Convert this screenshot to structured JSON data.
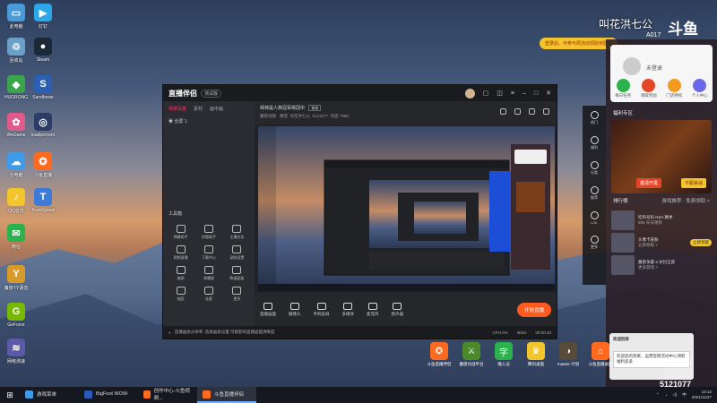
{
  "desktop_icons": [
    {
      "label": "此电脑",
      "color": "#4a9ad8",
      "glyph": "▭"
    },
    {
      "label": "钉钉",
      "color": "#2ea7e8",
      "glyph": "▶"
    },
    {
      "label": "回收站",
      "color": "#6aa0c8",
      "glyph": "♲"
    },
    {
      "label": "Steam",
      "color": "#1b2838",
      "glyph": "●"
    },
    {
      "label": "HUORONG",
      "color": "#3aa54a",
      "glyph": "◆"
    },
    {
      "label": "Sandboxie",
      "color": "#2b5fb3",
      "glyph": "S"
    },
    {
      "label": "WeGame",
      "color": "#e05a8a",
      "glyph": "✿"
    },
    {
      "label": "loadpercent",
      "color": "#2a3d66",
      "glyph": "◎"
    },
    {
      "label": "云电脑",
      "color": "#3f9be8",
      "glyph": "☁"
    },
    {
      "label": "斗鱼直播",
      "color": "#ff6a1f",
      "glyph": "✪"
    },
    {
      "label": "QQ音乐",
      "color": "#f3c52c",
      "glyph": "♪"
    },
    {
      "label": "TeamSpeak",
      "color": "#3c7bd8",
      "glyph": "T"
    },
    {
      "label": "微信",
      "color": "#2bb24c",
      "glyph": "✉"
    },
    {
      "label": "魔兽YY语音",
      "color": "#d89b2a",
      "glyph": "Y"
    },
    {
      "label": "GeForce",
      "color": "#76b900",
      "glyph": "G"
    },
    {
      "label": "网络测速",
      "color": "#5a5aa8",
      "glyph": "≋"
    }
  ],
  "stream_window": {
    "logo": "直播伴侣",
    "version": "测试版",
    "left_tabs": [
      "场景设置",
      "素材",
      "画中画"
    ],
    "scene_item": "全屏 1",
    "tools_label": "工具箱",
    "tools": [
      "弹幕助手",
      "房管助手",
      "主播任务",
      "视频直播",
      "下载中心",
      "录制设置",
      "美颜",
      "弹幕姬",
      "数据面板",
      "抽奖",
      "连麦",
      "更多"
    ],
    "room_title": "拜荷是人族冠军候冠中",
    "room_tag": "修改",
    "room_sub1": "魔兽地图 · 暴雪",
    "room_sub2": "叫花洪七公",
    "room_sub3": "5121077",
    "room_sub4": "热度 7988",
    "bottom_tools": [
      "直播画面",
      "摄像头",
      "手机投屏",
      "多媒体",
      "麦克风",
      "扬声器"
    ],
    "go_live": "开始直播",
    "status_text": "直播画质分辨率: 选择画质设置 可能影响直播画面清晰度",
    "stat_cpu": "CPU:3%",
    "stat_net": "0kb/s",
    "stat_time": "00:00:33"
  },
  "overlay": {
    "watermark": "叫花洪七公",
    "room_number": "斗鱼",
    "a_code": "A017",
    "promo": "登录后，可参与周活动领取奖励哦",
    "login": "未登录",
    "quick": [
      {
        "label": "每日任务",
        "color": "#2bb24c"
      },
      {
        "label": "领取奖励",
        "color": "#e5462a"
      },
      {
        "label": "门店特权",
        "color": "#f39a1f"
      },
      {
        "label": "个人中心",
        "color": "#6a6ae8"
      }
    ],
    "sec_welfare": "福利专区",
    "banner_btn1": "邀请开黑",
    "banner_btn2": "不服来战",
    "sec_rank": "排行榜",
    "sec_rank_more": "游戏推荐 · 免费领取 >",
    "rows": [
      {
        "title": "吃鸡号码 NSA 赛季",
        "sub": "¥69 天天领券",
        "btn": ""
      },
      {
        "title": "头像卡皮肤",
        "sub": "立即领取 >",
        "btn": "立即领取"
      },
      {
        "title": "魔兽争霸 3 冰封王座",
        "sub": "更多游戏 >",
        "btn": ""
      }
    ],
    "notif_title": "欢迎回来",
    "notif_body": "欢迎您的到来，运营官网活动中心领取福利多多"
  },
  "side_strip": [
    "热门",
    "福利",
    "分类",
    "推荐",
    "LOL",
    "更多"
  ],
  "dock": [
    {
      "label": "斗鱼直播伴侣",
      "color": "#ff6a1f",
      "glyph": "✪"
    },
    {
      "label": "魔兽对战平台",
      "color": "#4a8a2a",
      "glyph": "⚔"
    },
    {
      "label": "输入法",
      "color": "#2bb24c",
      "glyph": "字"
    },
    {
      "label": "腾讯桌面",
      "color": "#f3c52c",
      "glyph": "♛"
    },
    {
      "label": "master-计划",
      "color": "#5a4a3a",
      "glyph": "◑"
    },
    {
      "label": "斗鱼直播桌面",
      "color": "#ff6a1f",
      "glyph": "⌂"
    }
  ],
  "taskbar": {
    "start": "⊞",
    "items": [
      {
        "label": "游戏菜单",
        "color": "#3f9be8",
        "active": false
      },
      {
        "label": "BigFoot WOW",
        "color": "#2a5ab8",
        "active": false
      },
      {
        "label": "创作中心-斗鱼视频...",
        "color": "#ff6a1f",
        "active": false
      },
      {
        "label": "斗鱼直播伴侣",
        "color": "#ff6a1f",
        "active": true
      }
    ],
    "lang": "中",
    "time": "14:12",
    "date": "2021/11/27"
  }
}
